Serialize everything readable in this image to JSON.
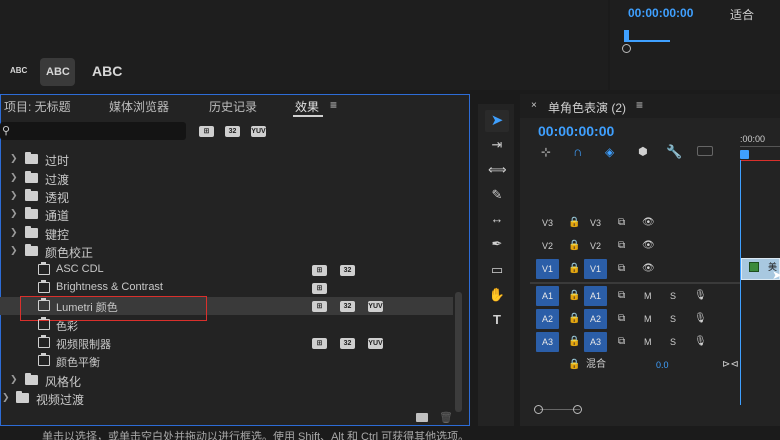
{
  "top_right": {
    "timecode": "00:00:00:00",
    "fit_label": "适合"
  },
  "text_styles": {
    "small": "ABC",
    "medium": "ABC",
    "large": "ABC"
  },
  "effects_panel": {
    "tabs": [
      "项目: 无标题",
      "媒体浏览器",
      "历史记录",
      "效果"
    ],
    "menu_icon": "hamburger-icon",
    "search_icon": "search-icon",
    "filter_badges": [
      "32",
      "YUV"
    ],
    "tree": [
      {
        "label": "过时",
        "type": "folder"
      },
      {
        "label": "过渡",
        "type": "folder"
      },
      {
        "label": "透视",
        "type": "folder"
      },
      {
        "label": "通道",
        "type": "folder"
      },
      {
        "label": "键控",
        "type": "folder"
      },
      {
        "label": "颜色校正",
        "type": "folder-open"
      },
      {
        "label": "ASC CDL",
        "type": "effect"
      },
      {
        "label": "Brightness & Contrast",
        "type": "effect"
      },
      {
        "label": "Lumetri 颜色",
        "type": "effect",
        "selected": true
      },
      {
        "label": "色彩",
        "type": "effect"
      },
      {
        "label": "视频限制器",
        "type": "effect"
      },
      {
        "label": "颜色平衡",
        "type": "effect"
      },
      {
        "label": "风格化",
        "type": "folder"
      },
      {
        "label": "视频过渡",
        "type": "folder"
      }
    ]
  },
  "status_bar": {
    "text": "单击以选择，或单击空白处并拖动以进行框选。使用 Shift、Alt 和 Ctrl 可获得其他选项。"
  },
  "timeline": {
    "title": "单角色表演 (2)",
    "timecode": "00:00:00:00",
    "ruler_start": ":00:00",
    "tracks": [
      {
        "id": "V3",
        "src": "V3"
      },
      {
        "id": "V2",
        "src": "V2"
      },
      {
        "id": "V1",
        "src": "V1"
      },
      {
        "id": "A1",
        "src": "A1"
      },
      {
        "id": "A2",
        "src": "A2"
      },
      {
        "id": "A3",
        "src": "A3"
      }
    ],
    "mix_label": "混合",
    "mix_value": "0.0",
    "mute_label": "M",
    "solo_label": "S"
  },
  "colors": {
    "accent_blue": "#2d6cd6",
    "timecode_blue": "#3fa0ff",
    "highlight_red": "#d9302c"
  }
}
